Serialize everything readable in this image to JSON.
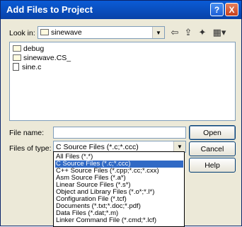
{
  "window": {
    "title": "Add Files to Project",
    "help_button": "?",
    "close_button": "X"
  },
  "look_in": {
    "label": "Look in:",
    "value": "sinewave"
  },
  "toolbar": {
    "back": "⇦",
    "up_folder": "⇪",
    "new_folder": "✦",
    "views": "▦▾"
  },
  "file_list": [
    {
      "name": "debug",
      "icon": "folder-icon"
    },
    {
      "name": "sinewave.CS_",
      "icon": "folder-icon"
    },
    {
      "name": "sine.c",
      "icon": "c-file-icon"
    }
  ],
  "file_name": {
    "label": "File name:",
    "value": ""
  },
  "file_type": {
    "label": "Files of type:",
    "value": "C Source Files (*.c;*.ccc)",
    "options": [
      "All Files (*.*)",
      "C Source Files (*.c;*.ccc)",
      "C++ Source Files (*.cpp;*.cc;*.cxx)",
      "Asm Source Files (*.a*)",
      "Linear Source Files (*.s*)",
      "Object and Library Files (*.o*;*.l*)",
      "Configuration File (*.tcf)",
      "Documents (*.txt;*.doc;*.pdf)",
      "Data Files (*.dat;*.m)",
      "Linker Command File (*.cmd;*.lcf)"
    ],
    "selected_index": 1
  },
  "buttons": {
    "open": "Open",
    "cancel": "Cancel",
    "help": "Help"
  }
}
